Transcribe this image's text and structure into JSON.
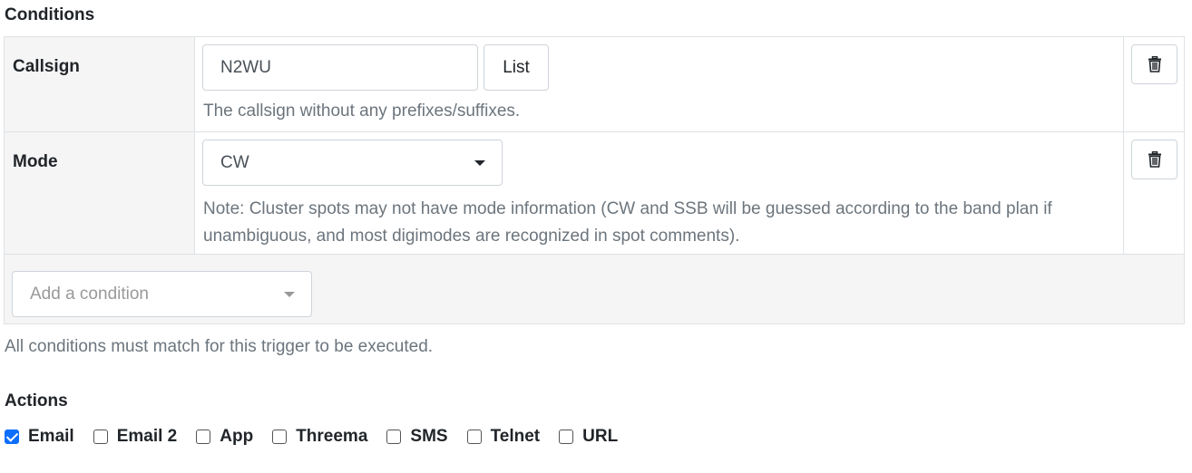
{
  "conditions": {
    "title": "Conditions",
    "callsign": {
      "label": "Callsign",
      "value": "N2WU",
      "list_button": "List",
      "help": "The callsign without any prefixes/suffixes."
    },
    "mode": {
      "label": "Mode",
      "selected": "CW",
      "help": "Note: Cluster spots may not have mode information (CW and SSB will be guessed according to the band plan if unambiguous, and most digimodes are recognized in spot comments)."
    },
    "add_condition": {
      "placeholder": "Add a condition"
    },
    "footer_note": "All conditions must match for this trigger to be executed."
  },
  "actions": {
    "title": "Actions",
    "items": [
      {
        "label": "Email",
        "checked": true
      },
      {
        "label": "Email 2",
        "checked": false
      },
      {
        "label": "App",
        "checked": false
      },
      {
        "label": "Threema",
        "checked": false
      },
      {
        "label": "SMS",
        "checked": false
      },
      {
        "label": "Telnet",
        "checked": false
      },
      {
        "label": "URL",
        "checked": false
      }
    ]
  },
  "icons": {
    "delete": "trash-icon",
    "dropdown": "caret-down-icon"
  },
  "colors": {
    "checkbox_checked": "#0d6efd",
    "label_cell_bg": "#f5f5f5",
    "border": "#dee2e6",
    "muted_text": "#6c757d"
  }
}
